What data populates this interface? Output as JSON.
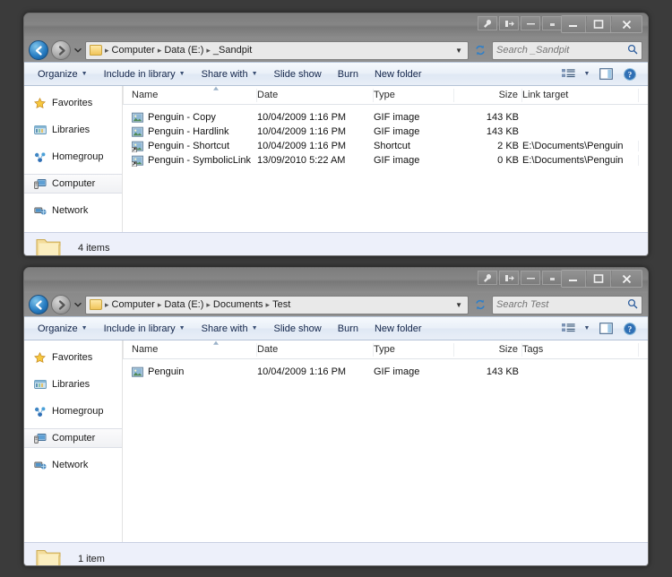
{
  "desktop": {
    "background": "#3b3b3b"
  },
  "windows": [
    {
      "id": "top",
      "titlebar": {
        "tools": [
          {
            "name": "wrench-icon",
            "label": "Tools"
          },
          {
            "name": "pin-icon",
            "label": "Pin"
          },
          {
            "name": "minimize-dash-icon",
            "label": "Collapse"
          },
          {
            "name": "small-square-icon",
            "label": "Restore"
          }
        ],
        "window_controls": [
          {
            "name": "minimize-button",
            "label": "Minimize"
          },
          {
            "name": "maximize-button",
            "label": "Maximize"
          },
          {
            "name": "close-button",
            "label": "Close"
          }
        ]
      },
      "navigation": {
        "back_label": "Back",
        "forward_label": "Forward",
        "recent_pages_label": "Recent pages",
        "refresh_label": "Refresh"
      },
      "breadcrumb": [
        "Computer",
        "Data (E:)",
        "_Sandpit"
      ],
      "search": {
        "placeholder": "Search _Sandpit",
        "value": ""
      },
      "toolbar": {
        "items": [
          {
            "label": "Organize",
            "has_caret": true
          },
          {
            "label": "Include in library",
            "has_caret": true
          },
          {
            "label": "Share with",
            "has_caret": true
          },
          {
            "label": "Slide show",
            "has_caret": false
          },
          {
            "label": "Burn",
            "has_caret": false
          },
          {
            "label": "New folder",
            "has_caret": false
          }
        ],
        "view_label": "Change your view",
        "preview_label": "Show the preview pane",
        "help_label": "Get help"
      },
      "sidebar": {
        "items": [
          {
            "label": "Favorites",
            "icon": "star-icon",
            "selected": false
          },
          {
            "label": "Libraries",
            "icon": "library-icon",
            "selected": false
          },
          {
            "label": "Homegroup",
            "icon": "homegroup-icon",
            "selected": false
          },
          {
            "label": "Computer",
            "icon": "computer-icon",
            "selected": true
          },
          {
            "label": "Network",
            "icon": "network-icon",
            "selected": false
          }
        ]
      },
      "columns": [
        "Name",
        "Date",
        "Type",
        "Size",
        "Link target"
      ],
      "files": [
        {
          "name": "Penguin - Copy",
          "date": "10/04/2009 1:16 PM",
          "type": "GIF image",
          "size": "143 KB",
          "link_target": "",
          "icon": "gif-image-icon"
        },
        {
          "name": "Penguin - Hardlink",
          "date": "10/04/2009 1:16 PM",
          "type": "GIF image",
          "size": "143 KB",
          "link_target": "",
          "icon": "gif-image-icon"
        },
        {
          "name": "Penguin - Shortcut",
          "date": "10/04/2009 1:16 PM",
          "type": "Shortcut",
          "size": "2 KB",
          "link_target": "E:\\Documents\\Penguin",
          "icon": "shortcut-icon"
        },
        {
          "name": "Penguin - SymbolicLink",
          "date": "13/09/2010 5:22 AM",
          "type": "GIF image",
          "size": "0 KB",
          "link_target": "E:\\Documents\\Penguin",
          "icon": "shortcut-icon"
        }
      ],
      "status": {
        "text": "4 items"
      }
    },
    {
      "id": "bottom",
      "titlebar": {
        "tools": [
          {
            "name": "wrench-icon",
            "label": "Tools"
          },
          {
            "name": "pin-icon",
            "label": "Pin"
          },
          {
            "name": "minimize-dash-icon",
            "label": "Collapse"
          },
          {
            "name": "small-square-icon",
            "label": "Restore"
          }
        ],
        "window_controls": [
          {
            "name": "minimize-button",
            "label": "Minimize"
          },
          {
            "name": "maximize-button",
            "label": "Maximize"
          },
          {
            "name": "close-button",
            "label": "Close"
          }
        ]
      },
      "navigation": {
        "back_label": "Back",
        "forward_label": "Forward",
        "recent_pages_label": "Recent pages",
        "refresh_label": "Refresh"
      },
      "breadcrumb": [
        "Computer",
        "Data (E:)",
        "Documents",
        "Test"
      ],
      "search": {
        "placeholder": "Search Test",
        "value": ""
      },
      "toolbar": {
        "items": [
          {
            "label": "Organize",
            "has_caret": true
          },
          {
            "label": "Include in library",
            "has_caret": true
          },
          {
            "label": "Share with",
            "has_caret": true
          },
          {
            "label": "Slide show",
            "has_caret": false
          },
          {
            "label": "Burn",
            "has_caret": false
          },
          {
            "label": "New folder",
            "has_caret": false
          }
        ],
        "view_label": "Change your view",
        "preview_label": "Show the preview pane",
        "help_label": "Get help"
      },
      "sidebar": {
        "items": [
          {
            "label": "Favorites",
            "icon": "star-icon",
            "selected": false
          },
          {
            "label": "Libraries",
            "icon": "library-icon",
            "selected": false
          },
          {
            "label": "Homegroup",
            "icon": "homegroup-icon",
            "selected": false
          },
          {
            "label": "Computer",
            "icon": "computer-icon",
            "selected": true
          },
          {
            "label": "Network",
            "icon": "network-icon",
            "selected": false
          }
        ]
      },
      "columns": [
        "Name",
        "Date",
        "Type",
        "Size",
        "Tags"
      ],
      "files": [
        {
          "name": "Penguin",
          "date": "10/04/2009 1:16 PM",
          "type": "GIF image",
          "size": "143 KB",
          "link_target": "",
          "icon": "gif-image-icon"
        }
      ],
      "status": {
        "text": "1 item"
      }
    }
  ]
}
